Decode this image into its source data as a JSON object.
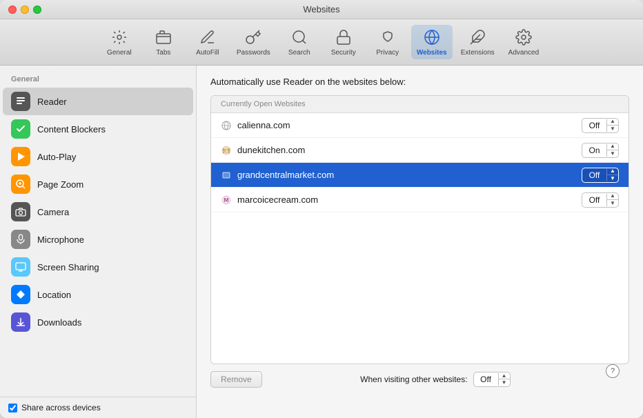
{
  "window": {
    "title": "Websites"
  },
  "toolbar": {
    "items": [
      {
        "id": "general",
        "label": "General",
        "icon": "⚙"
      },
      {
        "id": "tabs",
        "label": "Tabs",
        "icon": "⊞"
      },
      {
        "id": "autofill",
        "label": "AutoFill",
        "icon": "✏"
      },
      {
        "id": "passwords",
        "label": "Passwords",
        "icon": "🔑"
      },
      {
        "id": "search",
        "label": "Search",
        "icon": "🔍"
      },
      {
        "id": "security",
        "label": "Security",
        "icon": "🔒"
      },
      {
        "id": "privacy",
        "label": "Privacy",
        "icon": "✋"
      },
      {
        "id": "websites",
        "label": "Websites",
        "icon": "🌐",
        "active": true
      },
      {
        "id": "extensions",
        "label": "Extensions",
        "icon": "⊕"
      },
      {
        "id": "advanced",
        "label": "Advanced",
        "icon": "⚙"
      }
    ]
  },
  "sidebar": {
    "section_label": "General",
    "items": [
      {
        "id": "reader",
        "label": "Reader",
        "icon": "📄",
        "icon_class": "icon-reader",
        "selected": true
      },
      {
        "id": "content-blockers",
        "label": "Content Blockers",
        "icon": "✓",
        "icon_class": "icon-content-blockers"
      },
      {
        "id": "auto-play",
        "label": "Auto-Play",
        "icon": "▶",
        "icon_class": "icon-autoplay"
      },
      {
        "id": "page-zoom",
        "label": "Page Zoom",
        "icon": "🔍",
        "icon_class": "icon-page-zoom"
      },
      {
        "id": "camera",
        "label": "Camera",
        "icon": "📷",
        "icon_class": "icon-camera"
      },
      {
        "id": "microphone",
        "label": "Microphone",
        "icon": "🎤",
        "icon_class": "icon-microphone"
      },
      {
        "id": "screen-sharing",
        "label": "Screen Sharing",
        "icon": "🖥",
        "icon_class": "icon-screen-sharing"
      },
      {
        "id": "location",
        "label": "Location",
        "icon": "➤",
        "icon_class": "icon-location"
      },
      {
        "id": "downloads",
        "label": "Downloads",
        "icon": "⬇",
        "icon_class": "icon-downloads"
      }
    ],
    "share_checkbox": true,
    "share_label": "Share across devices"
  },
  "panel": {
    "header": "Automatically use Reader on the websites below:",
    "table_header": "Currently Open Websites",
    "rows": [
      {
        "id": "calienna",
        "favicon": "⚙",
        "label": "calienna.com",
        "value": "Off",
        "selected": false
      },
      {
        "id": "dunekitchen",
        "favicon": "🍽",
        "label": "dunekitchen.com",
        "value": "On",
        "selected": false
      },
      {
        "id": "grandcentral",
        "favicon": "■",
        "label": "grandcentralmarket.com",
        "value": "Off",
        "selected": true
      },
      {
        "id": "marcoicecream",
        "favicon": "Ⅿ",
        "label": "marcoicecream.com",
        "value": "Off",
        "selected": false
      }
    ],
    "remove_btn": "Remove",
    "other_websites_label": "When visiting other websites:",
    "other_websites_value": "Off",
    "help_label": "?"
  }
}
